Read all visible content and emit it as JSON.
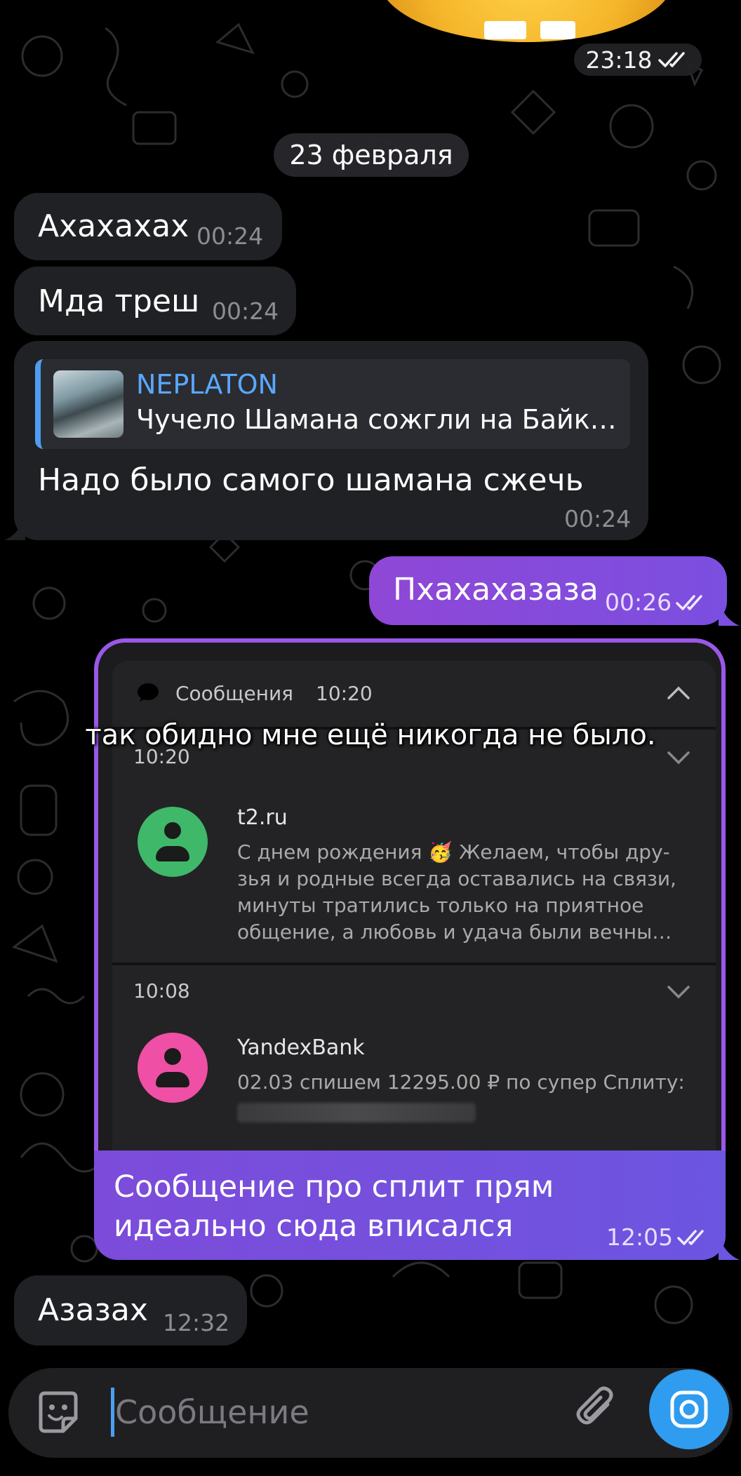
{
  "chat": {
    "top_time": "23:18",
    "date_label": "23 февраля",
    "messages": [
      {
        "text": "Ахахахах",
        "time": "00:24"
      },
      {
        "text": "Мда треш",
        "time": "00:24"
      },
      {
        "reply_author": "NEPLATON",
        "reply_text": "Чучело Шамана сожгли на Байк…",
        "text": "Надо было самого шамана сжечь",
        "time": "00:24"
      },
      {
        "text": "Пхахахазаза",
        "time": "00:26"
      },
      {
        "text_line1": "Сообщение про сплит прям",
        "text_line2": "идеально сюда вписался",
        "time": "12:05"
      },
      {
        "text": "Азазах",
        "time": "12:32"
      }
    ]
  },
  "screenshot": {
    "caption": "так обидно мне ещё никогда не было.",
    "header_app": "Сообщения",
    "header_time": "10:20",
    "notifications": [
      {
        "time": "10:20",
        "sender": "t2.ru",
        "line1": "С днем рождения 🥳 Желаем, чтобы дру-",
        "line2": "зья и родные всегда оставались на связи,",
        "line3": "минуты тратились только на приятное",
        "line4": "общение, а любовь и удача были вечны…",
        "avatar_color": "#3fb86a"
      },
      {
        "time": "10:08",
        "sender": "YandexBank",
        "line1": "02.03 спишем 12295.00 ₽ по супер Сплиту:",
        "avatar_color": "#ef4fa5"
      }
    ]
  },
  "composer": {
    "placeholder": "Сообщение"
  },
  "colors": {
    "incoming": "#202124",
    "outgoing": "#8a48da",
    "link": "#5aa7ff",
    "send_button": "#2f9cf0"
  }
}
